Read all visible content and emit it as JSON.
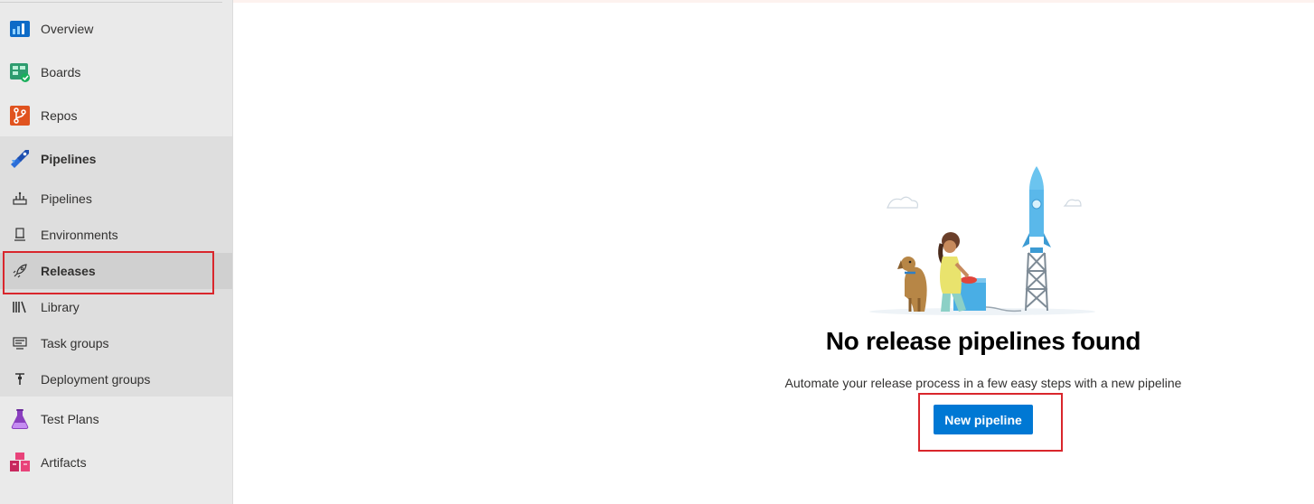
{
  "sidebar": {
    "top_items": [
      {
        "label": "Overview",
        "icon": "overview-icon"
      },
      {
        "label": "Boards",
        "icon": "boards-icon"
      },
      {
        "label": "Repos",
        "icon": "repos-icon"
      }
    ],
    "pipelines_group": {
      "label": "Pipelines",
      "icon": "pipelines-icon",
      "items": [
        {
          "label": "Pipelines",
          "icon": "pipelines-sub-icon"
        },
        {
          "label": "Environments",
          "icon": "environments-icon"
        },
        {
          "label": "Releases",
          "icon": "rocket-icon",
          "selected": true
        },
        {
          "label": "Library",
          "icon": "library-icon"
        },
        {
          "label": "Task groups",
          "icon": "task-groups-icon"
        },
        {
          "label": "Deployment groups",
          "icon": "deployment-groups-icon"
        }
      ]
    },
    "bottom_items": [
      {
        "label": "Test Plans",
        "icon": "test-plans-icon"
      },
      {
        "label": "Artifacts",
        "icon": "artifacts-icon"
      }
    ]
  },
  "main": {
    "empty_state": {
      "title": "No release pipelines found",
      "description": "Automate your release process in a few easy steps with a new pipeline",
      "button_label": "New pipeline",
      "illustration": "person-dog-rocket-illustration"
    }
  },
  "colors": {
    "accent": "#0078d4",
    "highlight": "#d9262c",
    "sidebar_bg": "#eaeaea",
    "group_bg": "#dedede",
    "selected_bg": "#d0d0d0"
  }
}
